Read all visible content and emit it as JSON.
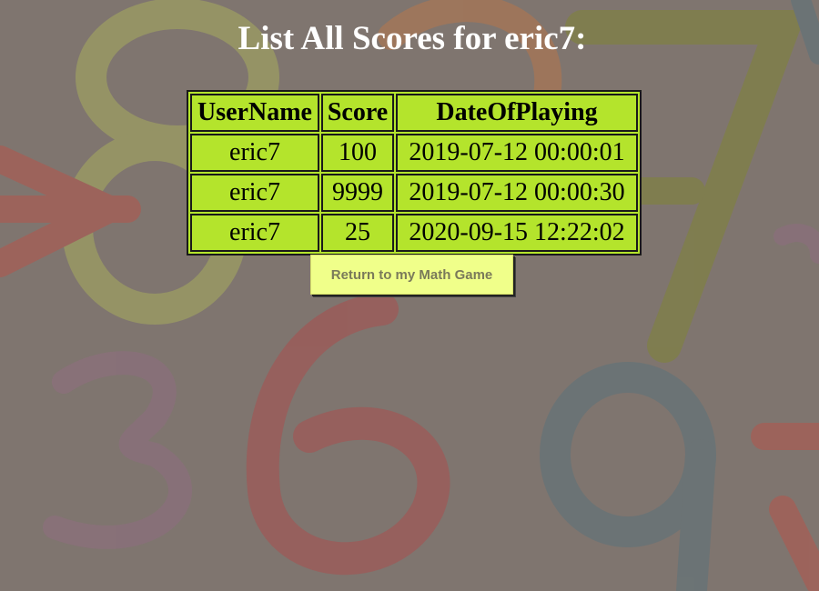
{
  "page": {
    "title": "List All Scores for eric7:",
    "background_color": "#7f756f"
  },
  "table": {
    "header_bg": "#b4e42c",
    "headers": [
      "UserName",
      "Score",
      "DateOfPlaying"
    ],
    "rows": [
      [
        "eric7",
        "100",
        "2019-07-12 00:00:01"
      ],
      [
        "eric7",
        "9999",
        "2019-07-12 00:00:30"
      ],
      [
        "eric7",
        "25",
        "2020-09-15 12:22:02"
      ]
    ]
  },
  "actions": {
    "return_label": "Return to my Math Game",
    "return_bg": "#f0ff8a"
  }
}
